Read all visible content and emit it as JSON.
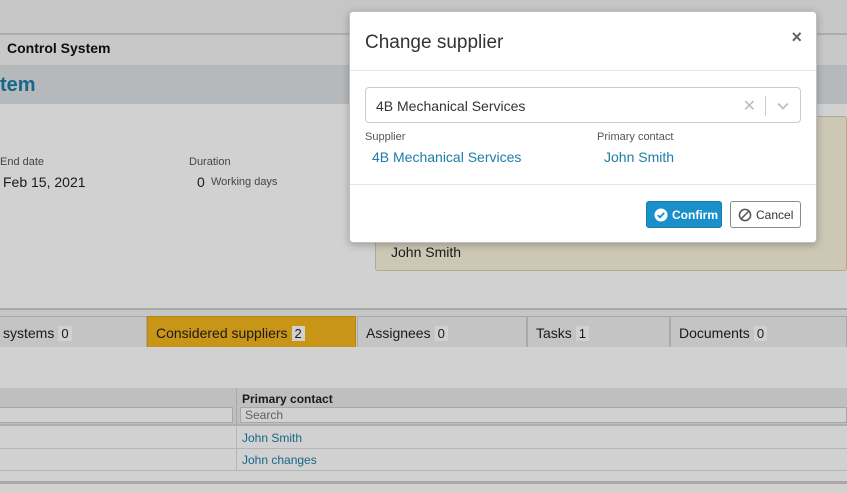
{
  "app": {
    "title": "Control System",
    "heading": "tem"
  },
  "fields": {
    "end_date_label": "End date",
    "end_date_value": "Feb 15, 2021",
    "duration_label": "Duration",
    "duration_value": "0",
    "duration_unit": "Working days"
  },
  "notes": {
    "contact": "John Smith"
  },
  "tabs": [
    {
      "label": "systems",
      "count": "0",
      "active": false
    },
    {
      "label": "Considered suppliers",
      "count": "2",
      "active": true
    },
    {
      "label": "Assignees",
      "count": "0",
      "active": false
    },
    {
      "label": "Tasks",
      "count": "1",
      "active": false
    },
    {
      "label": "Documents",
      "count": "0",
      "active": false
    }
  ],
  "table": {
    "column_header": "Primary contact",
    "search_placeholder": "Search",
    "rows": [
      "John Smith",
      "John changes"
    ]
  },
  "modal": {
    "title": "Change supplier",
    "select_value": "4B Mechanical Services",
    "supplier_label": "Supplier",
    "supplier_value": "4B Mechanical Services",
    "contact_label": "Primary contact",
    "contact_value": "John Smith",
    "confirm_label": "Confirm",
    "cancel_label": "Cancel"
  },
  "colors": {
    "accent": "#1a8fc9",
    "active_tab": "#f6b61b",
    "link": "#1c7ea8"
  }
}
